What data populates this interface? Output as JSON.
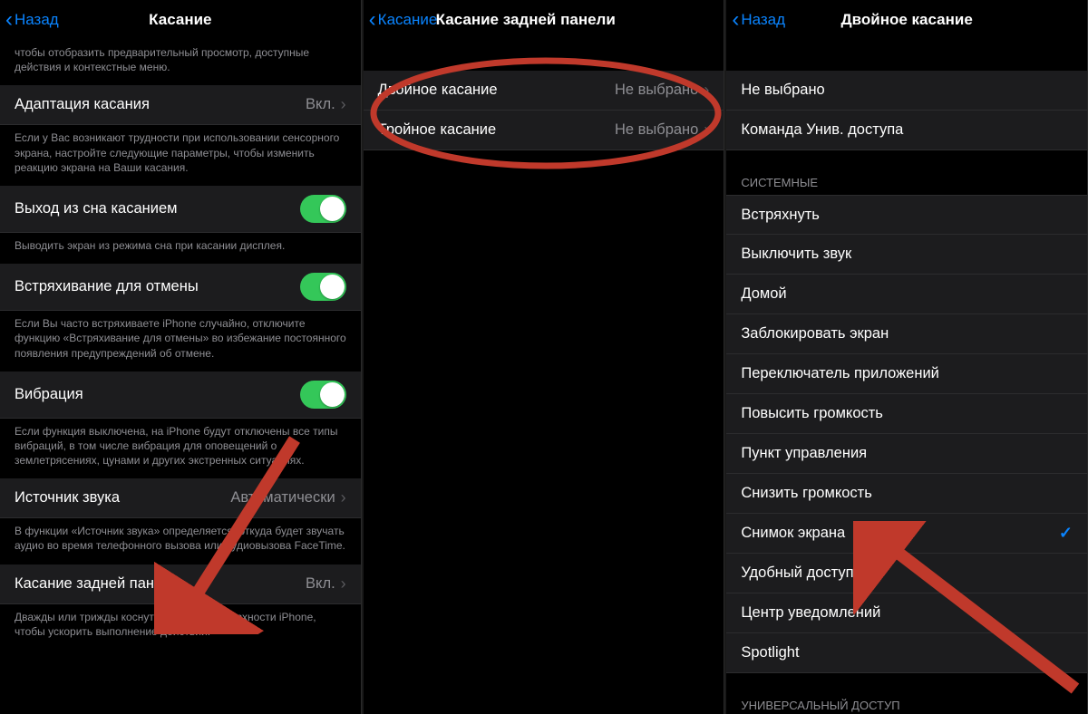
{
  "pane1": {
    "nav": {
      "back": "Назад",
      "title": "Касание"
    },
    "intro_footer": "чтобы отобразить предварительный просмотр, доступные действия и контекстные меню.",
    "rows": {
      "touch_accommodation": {
        "label": "Адаптация касания",
        "value": "Вкл."
      },
      "touch_accommodation_footer": "Если у Вас возникают трудности при использовании сенсорного экрана, настройте следующие параметры, чтобы изменить реакцию экрана на Ваши касания.",
      "tap_to_wake": {
        "label": "Выход из сна касанием"
      },
      "tap_to_wake_footer": "Выводить экран из режима сна при касании дисплея.",
      "shake_to_undo": {
        "label": "Встряхивание для отмены"
      },
      "shake_to_undo_footer": "Если Вы часто встряхиваете iPhone случайно, отключите функцию «Встряхивание для отмены» во избежание постоянного появления предупреждений об отмене.",
      "vibration": {
        "label": "Вибрация"
      },
      "vibration_footer": "Если функция выключена, на iPhone будут отключены все типы вибраций, в том числе вибрация для оповещений о землетрясениях, цунами и других экстренных ситуациях.",
      "audio_routing": {
        "label": "Источник звука",
        "value": "Автоматически"
      },
      "audio_routing_footer": "В функции «Источник звука» определяется, откуда будет звучать аудио во время телефонного вызова или аудиовызова FaceTime.",
      "back_tap": {
        "label": "Касание задней панели",
        "value": "Вкл."
      },
      "back_tap_footer": "Дважды или трижды коснуться задней поверхности iPhone, чтобы ускорить выполнение действий."
    }
  },
  "pane2": {
    "nav": {
      "back": "Касание",
      "title": "Касание задней панели"
    },
    "rows": {
      "double_tap": {
        "label": "Двойное касание",
        "value": "Не выбрано"
      },
      "triple_tap": {
        "label": "Тройное касание",
        "value": "Не выбрано"
      }
    }
  },
  "pane3": {
    "nav": {
      "back": "Назад",
      "title": "Двойное касание"
    },
    "top": {
      "none": "Не выбрано",
      "accessibility_shortcut": "Команда Унив. доступа"
    },
    "section_system": "СИСТЕМНЫЕ",
    "system": [
      "Встряхнуть",
      "Выключить звук",
      "Домой",
      "Заблокировать экран",
      "Переключатель приложений",
      "Повысить громкость",
      "Пункт управления",
      "Снизить громкость",
      "Снимок экрана",
      "Удобный доступ",
      "Центр уведомлений",
      "Spotlight"
    ],
    "system_checked_index": 8,
    "section_access": "УНИВЕРСАЛЬНЫЙ ДОСТУП"
  }
}
